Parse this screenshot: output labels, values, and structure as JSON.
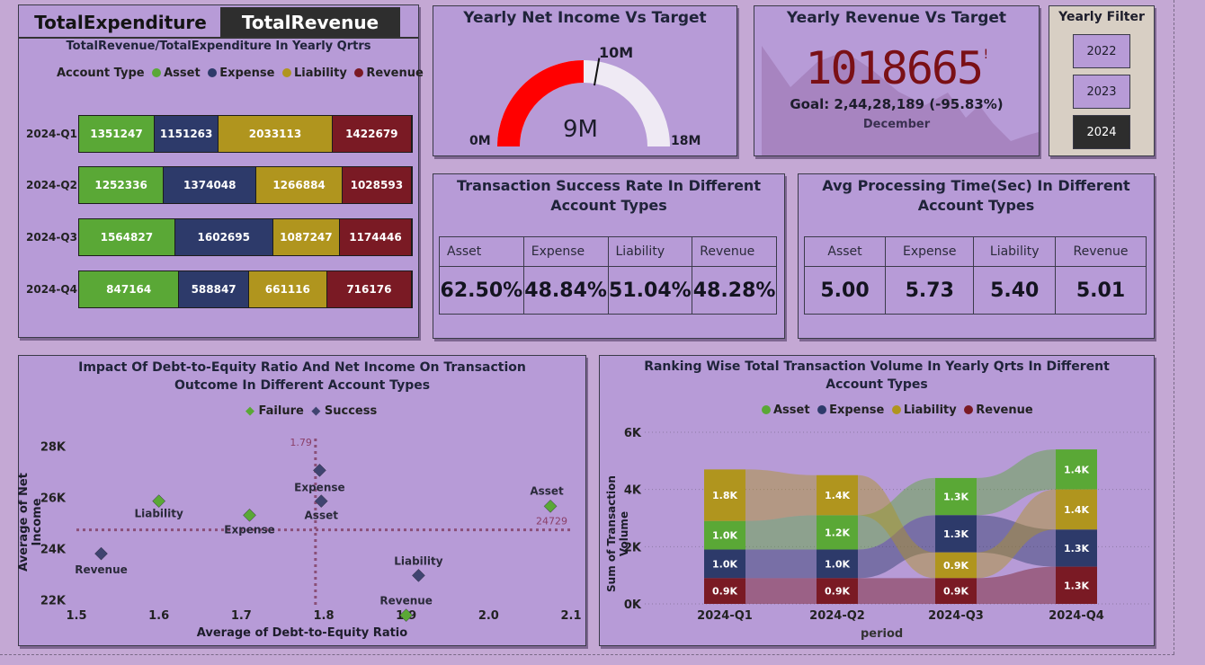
{
  "tabs": {
    "expenditure": "TotalExpenditure",
    "revenue": "TotalRevenue"
  },
  "qtr_chart": {
    "title": "TotalRevenue/TotalExpenditure In Yearly Qrtrs",
    "legend_title": "Account Type",
    "legend": [
      "Asset",
      "Expense",
      "Liability",
      "Revenue"
    ],
    "colors": {
      "Asset": "#5aa836",
      "Expense": "#2d3a6a",
      "Liability": "#b0951e",
      "Revenue": "#7a1a24"
    },
    "rows": [
      {
        "label": "2024-Q1",
        "values": [
          "1351247",
          "1151263",
          "2033113",
          "1422679"
        ]
      },
      {
        "label": "2024-Q2",
        "values": [
          "1252336",
          "1374048",
          "1266884",
          "1028593"
        ]
      },
      {
        "label": "2024-Q3",
        "values": [
          "1564827",
          "1602695",
          "1087247",
          "1174446"
        ]
      },
      {
        "label": "2024-Q4",
        "values": [
          "847164",
          "588847",
          "661116",
          "716176"
        ]
      }
    ]
  },
  "gauge": {
    "title": "Yearly Net Income Vs Target",
    "value_label": "9M",
    "min_label": "0M",
    "max_label": "18M",
    "target_label": "10M",
    "value": 9,
    "min": 0,
    "max": 18,
    "target": 10
  },
  "revenue_kpi": {
    "title": "Yearly Revenue Vs Target",
    "value": "1018665",
    "status": "!",
    "goal": "Goal: 2,44,28,189 (-95.83%)",
    "month": "December"
  },
  "yearly_filter": {
    "title": "Yearly Filter",
    "options": [
      "2022",
      "2023",
      "2024"
    ],
    "selected": "2024"
  },
  "success_rate": {
    "title": "Transaction Success Rate In Different Account Types",
    "headers": [
      "Asset",
      "Expense",
      "Liability",
      "Revenue"
    ],
    "values": [
      "62.50%",
      "48.84%",
      "51.04%",
      "48.28%"
    ]
  },
  "processing_time": {
    "title": "Avg Processing Time(Sec) In Different Account Types",
    "headers": [
      "Asset",
      "Expense",
      "Liability",
      "Revenue"
    ],
    "values": [
      "5.00",
      "5.73",
      "5.40",
      "5.01"
    ]
  },
  "chart_data": [
    {
      "type": "scatter",
      "title": "Impact Of Debt-to-Equity Ratio And Net Income On Transaction Outcome In Different Account Types",
      "xlabel": "Average of Debt-to-Equity Ratio",
      "ylabel": "Average of Net Income",
      "xlim": [
        1.5,
        2.1
      ],
      "ylim": [
        21000,
        28500
      ],
      "xticks": [
        "1.5",
        "1.6",
        "1.7",
        "1.8",
        "1.9",
        "2.0",
        "2.1"
      ],
      "yticks": [
        {
          "v": 22000,
          "t": "22K"
        },
        {
          "v": 24000,
          "t": "24K"
        },
        {
          "v": 26000,
          "t": "26K"
        },
        {
          "v": 28000,
          "t": "28K"
        }
      ],
      "legend": [
        "Failure",
        "Success"
      ],
      "series": [
        {
          "name": "Failure",
          "color": "#5aa836",
          "points": [
            {
              "label": "Liability",
              "x": 1.6,
              "y": 25850
            },
            {
              "label": "Expense",
              "x": 1.71,
              "y": 25300
            },
            {
              "label": "Asset",
              "x": 2.075,
              "y": 25650
            },
            {
              "label": "Revenue",
              "x": 1.9,
              "y": 21400
            }
          ]
        },
        {
          "name": "Success",
          "color": "#3f4470",
          "points": [
            {
              "label": "Expense",
              "x": 1.795,
              "y": 27050
            },
            {
              "label": "Asset",
              "x": 1.797,
              "y": 25850
            },
            {
              "label": "Revenue",
              "x": 1.53,
              "y": 23800
            },
            {
              "label": "Liability",
              "x": 1.915,
              "y": 22950
            }
          ]
        }
      ],
      "ref_lines": {
        "x": 1.79,
        "x_label": "1.79",
        "y": 24729,
        "y_label": "24729"
      }
    },
    {
      "type": "area",
      "title": "Ranking Wise Total Transaction Volume In Yearly Qrts In Different Account Types",
      "xlabel": "period",
      "ylabel": "Sum of Transaction Volume",
      "categories": [
        "2024-Q1",
        "2024-Q2",
        "2024-Q3",
        "2024-Q4"
      ],
      "ylim": [
        0,
        6000
      ],
      "yticks": [
        {
          "v": 0,
          "t": "0K"
        },
        {
          "v": 2000,
          "t": "2K"
        },
        {
          "v": 4000,
          "t": "4K"
        },
        {
          "v": 6000,
          "t": "6K"
        }
      ],
      "legend": [
        "Asset",
        "Expense",
        "Liability",
        "Revenue"
      ],
      "series": [
        {
          "name": "Asset",
          "color": "#5aa836",
          "values": [
            1000,
            1200,
            1300,
            1400
          ],
          "labels": [
            "1.0K",
            "1.2K",
            "1.3K",
            "1.4K"
          ]
        },
        {
          "name": "Expense",
          "color": "#2d3a6a",
          "values": [
            1000,
            1000,
            1300,
            1300
          ],
          "labels": [
            "1.0K",
            "1.0K",
            "1.3K",
            "1.3K"
          ]
        },
        {
          "name": "Liability",
          "color": "#b0951e",
          "values": [
            1800,
            1400,
            900,
            1400
          ],
          "labels": [
            "1.8K",
            "1.4K",
            "0.9K",
            "1.4K"
          ]
        },
        {
          "name": "Revenue",
          "color": "#7a1a24",
          "values": [
            900,
            900,
            900,
            1300
          ],
          "labels": [
            "0.9K",
            "0.9K",
            "0.9K",
            "1.3K"
          ]
        }
      ]
    }
  ]
}
